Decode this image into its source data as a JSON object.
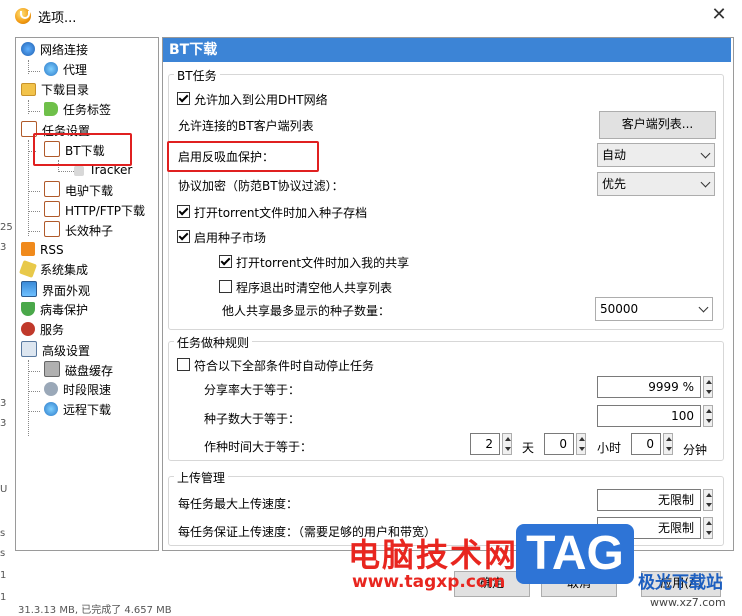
{
  "window": {
    "title": "选项..."
  },
  "bg_strip": [
    "25",
    "3",
    "3",
    "3",
    " ",
    "U",
    "s",
    "s",
    "1",
    "1"
  ],
  "tree": {
    "items": [
      {
        "label": "网络连接",
        "icon": "network-icon"
      },
      {
        "label": "代理",
        "icon": "proxy-globe-icon"
      },
      {
        "label": "下载目录",
        "icon": "folder-icon"
      },
      {
        "label": "任务标签",
        "icon": "tag-icon"
      },
      {
        "label": "任务设置",
        "icon": "task-settings-icon"
      },
      {
        "label": "BT下载",
        "icon": "bt-download-icon"
      },
      {
        "label": "Tracker",
        "icon": "tracker-icon"
      },
      {
        "label": "电驴下载",
        "icon": "emule-icon"
      },
      {
        "label": "HTTP/FTP下载",
        "icon": "http-ftp-icon"
      },
      {
        "label": "长效种子",
        "icon": "seed-icon"
      },
      {
        "label": "RSS",
        "icon": "rss-icon"
      },
      {
        "label": "系统集成",
        "icon": "integration-icon"
      },
      {
        "label": "界面外观",
        "icon": "appearance-icon"
      },
      {
        "label": "病毒保护",
        "icon": "virus-shield-icon"
      },
      {
        "label": "服务",
        "icon": "service-icon"
      },
      {
        "label": "高级设置",
        "icon": "advanced-icon"
      },
      {
        "label": "磁盘缓存",
        "icon": "disk-cache-icon"
      },
      {
        "label": "时段限速",
        "icon": "speed-limit-icon"
      },
      {
        "label": "远程下载",
        "icon": "remote-download-icon"
      }
    ]
  },
  "panel": {
    "header": "BT下载",
    "bt_task": {
      "legend": "BT任务",
      "allow_dht": "允许加入到公用DHT网络",
      "allowed_clients": "允许连接的BT客户端列表",
      "client_list_btn": "客户端列表...",
      "anti_leech_label": "启用反吸血保护：",
      "anti_leech_value": "自动",
      "encryption_label": "协议加密（防范BT协议过滤）：",
      "encryption_value": "优先",
      "open_torrent_add": "打开torrent文件时加入种子存档",
      "enable_market": "启用种子市场",
      "open_torrent_share": "打开torrent文件时加入我的共享",
      "clear_on_exit": "程序退出时清空他人共享列表",
      "max_shown_label": "他人共享最多显示的种子数量：",
      "max_shown_value": "50000"
    },
    "seeding": {
      "legend": "任务做种规则",
      "auto_stop": "符合以下全部条件时自动停止任务",
      "ratio_label": "分享率大于等于：",
      "ratio_value": "9999 %",
      "seeds_label": "种子数大于等于：",
      "seeds_value": "100",
      "time_label": "作种时间大于等于：",
      "days_value": "2",
      "days_unit": "天",
      "hours_value": "0",
      "hours_unit": "小时",
      "minutes_value": "0",
      "minutes_unit": "分钟"
    },
    "upload": {
      "legend": "上传管理",
      "max_speed_label": "每任务最大上传速度：",
      "max_speed_value": "无限制",
      "guaranteed_label": "每任务保证上传速度：（需要足够的用户和带宽）",
      "guaranteed_value": "无限制"
    }
  },
  "footer": {
    "ok": "确定",
    "cancel": "取消",
    "apply": "应用(A)",
    "status": "31.3.13 MB, 已完成了 4.657 MB"
  },
  "watermark": {
    "brand": "电脑技术网",
    "url": "www.tagxp.com",
    "tag": "TAG",
    "site": "极光下载站",
    "site_url": "www.xz7.com"
  }
}
